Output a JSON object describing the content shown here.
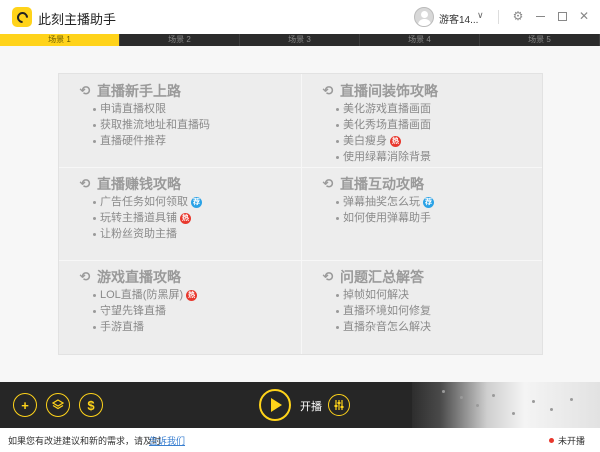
{
  "app": {
    "title": "此刻主播助手"
  },
  "user": {
    "name": "游客14...",
    "dropdown_icon": "chevron-down-icon"
  },
  "window_controls": [
    "gear-icon",
    "minimize-icon",
    "maximize-icon",
    "close-icon"
  ],
  "scene_tabs": [
    {
      "label": "场景 1",
      "active": true
    },
    {
      "label": "场景 2",
      "active": false
    },
    {
      "label": "场景 3",
      "active": false
    },
    {
      "label": "场景 4",
      "active": false
    },
    {
      "label": "场景 5",
      "active": false
    }
  ],
  "sections": [
    {
      "title": "直播新手上路",
      "items": [
        {
          "label": "申请直播权限",
          "badge": null
        },
        {
          "label": "获取推流地址和直播码",
          "badge": null
        },
        {
          "label": "直播硬件推荐",
          "badge": null
        }
      ]
    },
    {
      "title": "直播间装饰攻略",
      "items": [
        {
          "label": "美化游戏直播画面",
          "badge": null
        },
        {
          "label": "美化秀场直播画面",
          "badge": null
        },
        {
          "label": "美白瘦身",
          "badge": "热"
        },
        {
          "label": "使用绿幕消除背景",
          "badge": null
        }
      ]
    },
    {
      "title": "直播赚钱攻略",
      "items": [
        {
          "label": "广告任务如何领取",
          "badge": "荐"
        },
        {
          "label": "玩转主播道具铺",
          "badge": "热"
        },
        {
          "label": "让粉丝资助主播",
          "badge": null
        }
      ]
    },
    {
      "title": "直播互动攻略",
      "items": [
        {
          "label": "弹幕抽奖怎么玩",
          "badge": "荐"
        },
        {
          "label": "如何使用弹幕助手",
          "badge": null
        }
      ]
    },
    {
      "title": "游戏直播攻略",
      "items": [
        {
          "label": "LOL直播(防黑屏)",
          "badge": "热"
        },
        {
          "label": "守望先锋直播",
          "badge": null
        },
        {
          "label": "手游直播",
          "badge": null
        }
      ]
    },
    {
      "title": "问题汇总解答",
      "items": [
        {
          "label": "掉帧如何解决",
          "badge": null
        },
        {
          "label": "直播环境如何修复",
          "badge": null
        },
        {
          "label": "直播杂音怎么解决",
          "badge": null
        }
      ]
    }
  ],
  "controls": {
    "add_icon": "+",
    "layers_icon": "layers-icon",
    "money_icon": "$",
    "start_label": "开播",
    "mixer_icon": "mixer-icon",
    "accent": "#ffd31a"
  },
  "status": {
    "message": "如果您有改进建议和新的需求，请及时",
    "link": "告诉我们",
    "live_status": "未开播"
  }
}
